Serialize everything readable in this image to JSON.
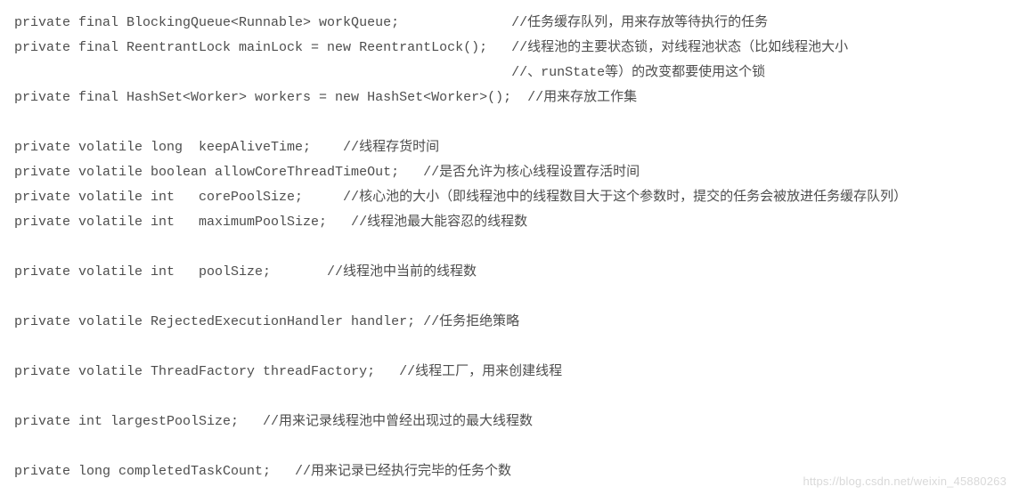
{
  "code": {
    "lines": [
      "private final BlockingQueue<Runnable> workQueue;              //任务缓存队列，用来存放等待执行的任务",
      "private final ReentrantLock mainLock = new ReentrantLock();   //线程池的主要状态锁，对线程池状态（比如线程池大小",
      "                                                              //、runState等）的改变都要使用这个锁",
      "private final HashSet<Worker> workers = new HashSet<Worker>();  //用来存放工作集",
      " ",
      "private volatile long  keepAliveTime;    //线程存货时间   ",
      "private volatile boolean allowCoreThreadTimeOut;   //是否允许为核心线程设置存活时间",
      "private volatile int   corePoolSize;     //核心池的大小（即线程池中的线程数目大于这个参数时，提交的任务会被放进任务缓存队列）",
      "private volatile int   maximumPoolSize;   //线程池最大能容忍的线程数",
      " ",
      "private volatile int   poolSize;       //线程池中当前的线程数",
      " ",
      "private volatile RejectedExecutionHandler handler; //任务拒绝策略",
      " ",
      "private volatile ThreadFactory threadFactory;   //线程工厂，用来创建线程",
      " ",
      "private int largestPoolSize;   //用来记录线程池中曾经出现过的最大线程数",
      " ",
      "private long completedTaskCount;   //用来记录已经执行完毕的任务个数"
    ]
  },
  "watermark": "https://blog.csdn.net/weixin_45880263"
}
